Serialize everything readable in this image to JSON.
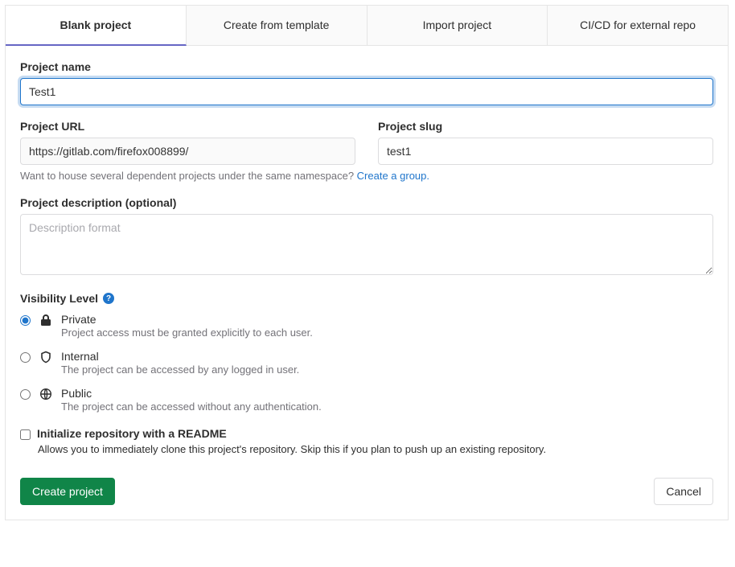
{
  "tabs": [
    {
      "label": "Blank project",
      "active": true
    },
    {
      "label": "Create from template",
      "active": false
    },
    {
      "label": "Import project",
      "active": false
    },
    {
      "label": "CI/CD for external repo",
      "active": false
    }
  ],
  "projectName": {
    "label": "Project name",
    "value": "Test1"
  },
  "projectUrl": {
    "label": "Project URL",
    "value": "https://gitlab.com/firefox008899/"
  },
  "projectSlug": {
    "label": "Project slug",
    "value": "test1"
  },
  "namespaceHelp": {
    "text": "Want to house several dependent projects under the same namespace? ",
    "linkText": "Create a group."
  },
  "description": {
    "label": "Project description (optional)",
    "placeholder": "Description format"
  },
  "visibility": {
    "label": "Visibility Level",
    "options": [
      {
        "key": "private",
        "title": "Private",
        "desc": "Project access must be granted explicitly to each user.",
        "checked": true
      },
      {
        "key": "internal",
        "title": "Internal",
        "desc": "The project can be accessed by any logged in user.",
        "checked": false
      },
      {
        "key": "public",
        "title": "Public",
        "desc": "The project can be accessed without any authentication.",
        "checked": false
      }
    ]
  },
  "readme": {
    "label": "Initialize repository with a README",
    "desc": "Allows you to immediately clone this project's repository. Skip this if you plan to push up an existing repository.",
    "checked": false
  },
  "actions": {
    "primary": "Create project",
    "cancel": "Cancel"
  }
}
